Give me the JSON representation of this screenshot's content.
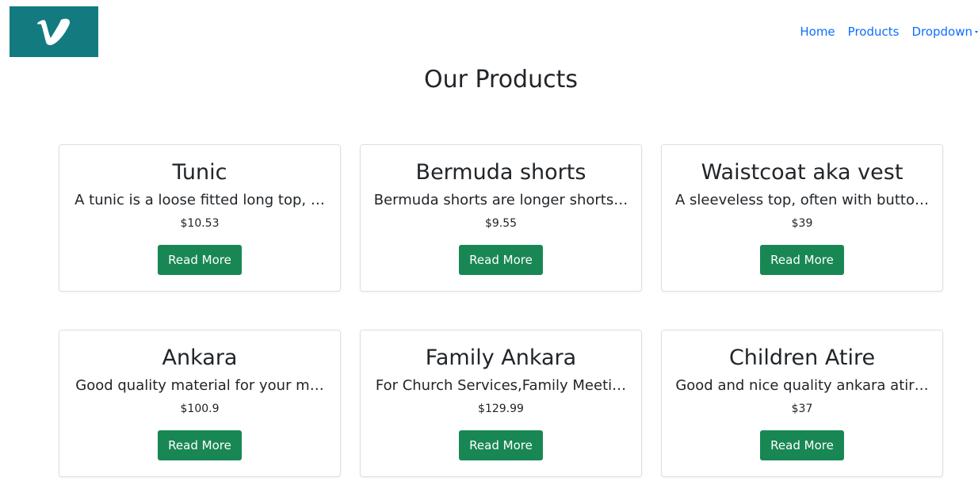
{
  "navbar": {
    "logo_icon": "vimeo-v-logo",
    "logo_color": "#137b80",
    "links": [
      {
        "label": "Home"
      },
      {
        "label": "Products"
      },
      {
        "label": "Dropdown"
      }
    ]
  },
  "page": {
    "title": "Our Products"
  },
  "products": [
    {
      "name": "Tunic",
      "description": "A tunic is a loose fitted long top, …",
      "price": "$10.53",
      "button": "Read More"
    },
    {
      "name": "Bermuda shorts",
      "description": "Bermuda shorts are longer shorts…",
      "price": "$9.55",
      "button": "Read More"
    },
    {
      "name": "Waistcoat aka vest",
      "description": "A sleeveless top, often with butto…",
      "price": "$39",
      "button": "Read More"
    },
    {
      "name": "Ankara",
      "description": "Good quality material for your m…",
      "price": "$100.9",
      "button": "Read More"
    },
    {
      "name": "Family Ankara",
      "description": "For Church Services,Family Meeti…",
      "price": "$129.99",
      "button": "Read More"
    },
    {
      "name": "Children Atire",
      "description": "Good and nice quality ankara atir…",
      "price": "$37",
      "button": "Read More"
    }
  ],
  "colors": {
    "link": "#0d6efd",
    "button": "#198754"
  }
}
